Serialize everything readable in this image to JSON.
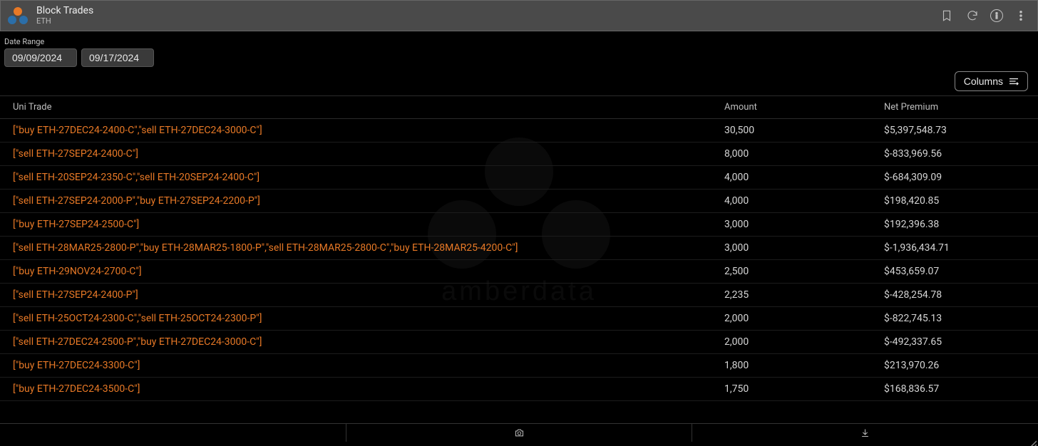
{
  "header": {
    "title": "Block Trades",
    "subtitle": "ETH"
  },
  "filters": {
    "date_range_label": "Date Range",
    "date_from": "09/09/2024",
    "date_to": "09/17/2024"
  },
  "columns_button": "Columns",
  "table": {
    "headers": {
      "uni_trade": "Uni Trade",
      "amount": "Amount",
      "net_premium": "Net Premium"
    },
    "rows": [
      {
        "trade": "[\"buy ETH-27DEC24-2400-C\",\"sell ETH-27DEC24-3000-C\"]",
        "amount": "30,500",
        "premium": "$5,397,548.73"
      },
      {
        "trade": "[\"sell ETH-27SEP24-2400-C\"]",
        "amount": "8,000",
        "premium": "$-833,969.56"
      },
      {
        "trade": "[\"sell ETH-20SEP24-2350-C\",\"sell ETH-20SEP24-2400-C\"]",
        "amount": "4,000",
        "premium": "$-684,309.09"
      },
      {
        "trade": "[\"sell ETH-27SEP24-2000-P\",\"buy ETH-27SEP24-2200-P\"]",
        "amount": "4,000",
        "premium": "$198,420.85"
      },
      {
        "trade": "[\"buy ETH-27SEP24-2500-C\"]",
        "amount": "3,000",
        "premium": "$192,396.38"
      },
      {
        "trade": "[\"sell ETH-28MAR25-2800-P\",\"buy ETH-28MAR25-1800-P\",\"sell ETH-28MAR25-2800-C\",\"buy ETH-28MAR25-4200-C\"]",
        "amount": "3,000",
        "premium": "$-1,936,434.71"
      },
      {
        "trade": "[\"buy ETH-29NOV24-2700-C\"]",
        "amount": "2,500",
        "premium": "$453,659.07"
      },
      {
        "trade": "[\"sell ETH-27SEP24-2400-P\"]",
        "amount": "2,235",
        "premium": "$-428,254.78"
      },
      {
        "trade": "[\"sell ETH-25OCT24-2300-C\",\"sell ETH-25OCT24-2300-P\"]",
        "amount": "2,000",
        "premium": "$-822,745.13"
      },
      {
        "trade": "[\"sell ETH-27DEC24-2500-P\",\"buy ETH-27DEC24-3000-C\"]",
        "amount": "2,000",
        "premium": "$-492,337.65"
      },
      {
        "trade": "[\"buy ETH-27DEC24-3300-C\"]",
        "amount": "1,800",
        "premium": "$213,970.26"
      },
      {
        "trade": "[\"buy ETH-27DEC24-3500-C\"]",
        "amount": "1,750",
        "premium": "$168,836.57"
      }
    ]
  }
}
